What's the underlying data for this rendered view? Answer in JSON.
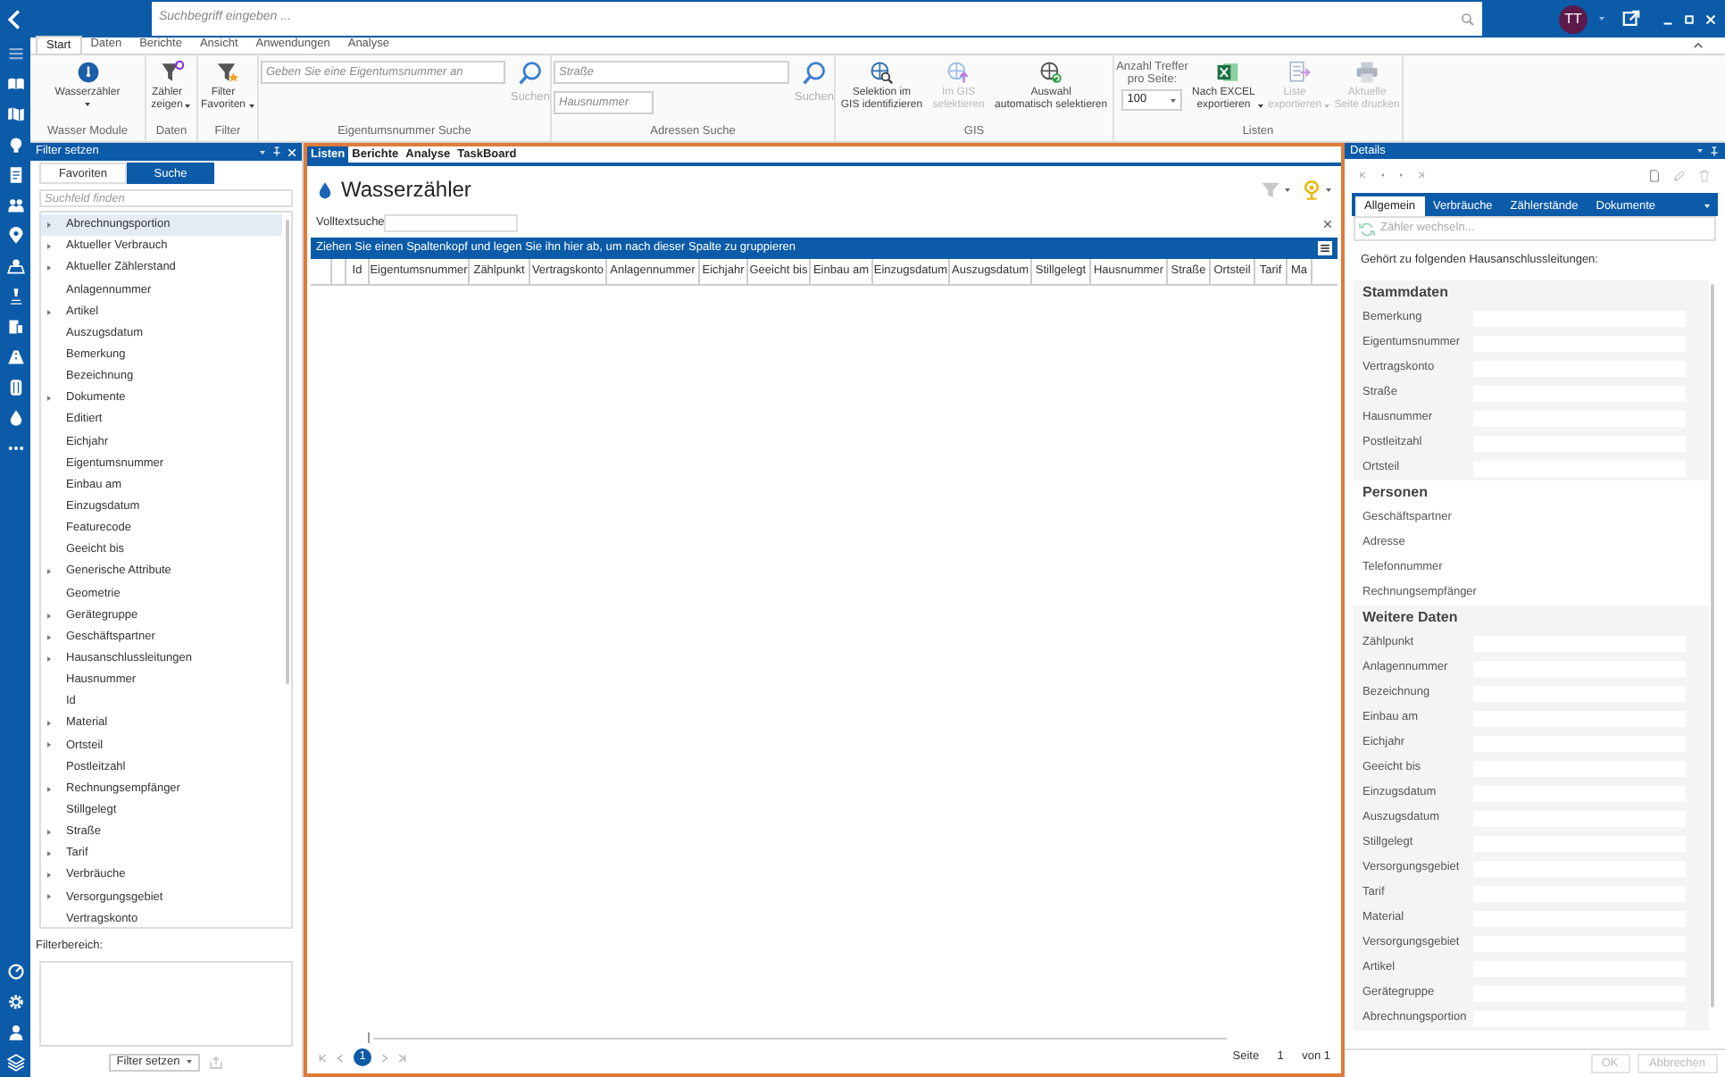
{
  "top_bar": {
    "search": {
      "placeholder": "Suchbegriff eingeben ..."
    },
    "avatar": "TT"
  },
  "ribbon": {
    "tabs": [
      {
        "label": "Start",
        "selected": true
      },
      {
        "label": "Daten",
        "selected": false
      },
      {
        "label": "Berichte",
        "selected": false
      },
      {
        "label": "Ansicht",
        "selected": false
      },
      {
        "label": "Anwendungen",
        "selected": false
      },
      {
        "label": "Analyse",
        "selected": false
      }
    ],
    "groups": [
      {
        "label": "Wasser Module",
        "items": [
          {
            "kind": "button",
            "label": "Wasserzähler",
            "dropdown": true,
            "disabled": false
          }
        ]
      },
      {
        "label": "Daten",
        "items": [
          {
            "kind": "button",
            "label": "Zähler\nzeigen",
            "dropdown": true,
            "disabled": false
          }
        ]
      },
      {
        "label": "Filter",
        "items": [
          {
            "kind": "button",
            "label": "Filter\nFavoriten",
            "dropdown": true,
            "disabled": false
          }
        ]
      },
      {
        "label": "Eigentumsnummer Suche",
        "items": [
          {
            "kind": "search",
            "fields": [
              {
                "placeholder": "Geben Sie eine Eigentumsnummer an"
              }
            ],
            "button": "Suchen"
          }
        ]
      },
      {
        "label": "Adressen Suche",
        "items": [
          {
            "kind": "search",
            "fields": [
              {
                "placeholder": "Straße"
              },
              {
                "placeholder": "Hausnummer"
              }
            ],
            "button": "Suchen"
          }
        ]
      },
      {
        "label": "GIS",
        "items": [
          {
            "kind": "button",
            "label": "Selektion im\nGIS identifizieren",
            "dropdown": false,
            "disabled": false
          },
          {
            "kind": "button",
            "label": "Im GIS\nselektieren",
            "dropdown": false,
            "disabled": true
          },
          {
            "kind": "button",
            "label": "Auswahl\nautomatisch selektieren",
            "dropdown": false,
            "disabled": false
          }
        ]
      },
      {
        "label": "Listen",
        "items": [
          {
            "kind": "select",
            "label": "Anzahl Treffer\npro Seite:",
            "value": "100"
          },
          {
            "kind": "button",
            "label": "Nach EXCEL\nexportieren",
            "dropdown": true,
            "disabled": false
          },
          {
            "kind": "button",
            "label": "Liste\nexportieren",
            "dropdown": true,
            "disabled": true
          },
          {
            "kind": "button",
            "label": "Aktuelle\nSeite drucken",
            "dropdown": false,
            "disabled": true
          }
        ]
      }
    ]
  },
  "filter_panel": {
    "title": "Filter setzen",
    "tabs": [
      {
        "label": "Favoriten",
        "selected": false
      },
      {
        "label": "Suche",
        "selected": true
      }
    ],
    "search": {
      "placeholder": "Suchfeld finden"
    },
    "fields": [
      {
        "label": "Abrechnungsportion",
        "expandable": true,
        "selected": true
      },
      {
        "label": "Aktueller Verbrauch",
        "expandable": true,
        "selected": false
      },
      {
        "label": "Aktueller Zählerstand",
        "expandable": true,
        "selected": false
      },
      {
        "label": "Anlagennummer",
        "expandable": false,
        "selected": false
      },
      {
        "label": "Artikel",
        "expandable": true,
        "selected": false
      },
      {
        "label": "Auszugsdatum",
        "expandable": false,
        "selected": false
      },
      {
        "label": "Bemerkung",
        "expandable": false,
        "selected": false
      },
      {
        "label": "Bezeichnung",
        "expandable": false,
        "selected": false
      },
      {
        "label": "Dokumente",
        "expandable": true,
        "selected": false
      },
      {
        "label": "Editiert",
        "expandable": false,
        "selected": false
      },
      {
        "label": "Eichjahr",
        "expandable": false,
        "selected": false
      },
      {
        "label": "Eigentumsnummer",
        "expandable": false,
        "selected": false
      },
      {
        "label": "Einbau am",
        "expandable": false,
        "selected": false
      },
      {
        "label": "Einzugsdatum",
        "expandable": false,
        "selected": false
      },
      {
        "label": "Featurecode",
        "expandable": false,
        "selected": false
      },
      {
        "label": "Geeicht bis",
        "expandable": false,
        "selected": false
      },
      {
        "label": "Generische Attribute",
        "expandable": true,
        "selected": false
      },
      {
        "label": "Geometrie",
        "expandable": false,
        "selected": false
      },
      {
        "label": "Gerätegruppe",
        "expandable": true,
        "selected": false
      },
      {
        "label": "Geschäftspartner",
        "expandable": true,
        "selected": false
      },
      {
        "label": "Hausanschlussleitungen",
        "expandable": true,
        "selected": false
      },
      {
        "label": "Hausnummer",
        "expandable": false,
        "selected": false
      },
      {
        "label": "Id",
        "expandable": false,
        "selected": false
      },
      {
        "label": "Material",
        "expandable": true,
        "selected": false
      },
      {
        "label": "Ortsteil",
        "expandable": true,
        "selected": false
      },
      {
        "label": "Postleitzahl",
        "expandable": false,
        "selected": false
      },
      {
        "label": "Rechnungsempfänger",
        "expandable": true,
        "selected": false
      },
      {
        "label": "Stillgelegt",
        "expandable": false,
        "selected": false
      },
      {
        "label": "Straße",
        "expandable": true,
        "selected": false
      },
      {
        "label": "Tarif",
        "expandable": true,
        "selected": false
      },
      {
        "label": "Verbräuche",
        "expandable": true,
        "selected": false
      },
      {
        "label": "Versorgungsgebiet",
        "expandable": true,
        "selected": false
      },
      {
        "label": "Vertragskonto",
        "expandable": false,
        "selected": false
      }
    ],
    "filter_area": {
      "label": "Filterbereich:"
    },
    "apply_button": "Filter setzen"
  },
  "list_view": {
    "tabs": [
      {
        "label": "Listen",
        "selected": true
      },
      {
        "label": "Berichte",
        "selected": false
      },
      {
        "label": "Analyse",
        "selected": false
      },
      {
        "label": "TaskBoard",
        "selected": false
      }
    ],
    "title": "Wasserzähler",
    "fulltext": {
      "label": "Volltextsuche"
    },
    "group_hint": "Ziehen Sie einen Spaltenkopf und legen Sie ihn hier ab, um nach dieser Spalte zu gruppieren",
    "columns": [
      "Id",
      "Eigentumsnummer",
      "Zählpunkt",
      "Vertragskonto",
      "Anlagennummer",
      "Eichjahr",
      "Geeicht bis",
      "Einbau am",
      "Einzugsdatum",
      "Auszugsdatum",
      "Stillgelegt",
      "Hausnummer",
      "Straße",
      "Ortsteil",
      "Tarif",
      "Ma"
    ],
    "pager": {
      "current_page": "1",
      "page_label": "Seite",
      "page_value": "1",
      "page_total": "von 1"
    }
  },
  "details": {
    "title": "Details",
    "tabs": [
      {
        "label": "Allgemein",
        "selected": true
      },
      {
        "label": "Verbräuche",
        "selected": false
      },
      {
        "label": "Zählerstände",
        "selected": false
      },
      {
        "label": "Dokumente",
        "selected": false
      }
    ],
    "meter_field": {
      "placeholder": "Zähler wechseln..."
    },
    "relation_text": "Gehört zu folgenden Hausanschlussleitungen:",
    "sections": [
      {
        "title": "Stammdaten",
        "kind": "form",
        "fields": [
          "Bemerkung",
          "Eigentumsnummer",
          "Vertragskonto",
          "Straße",
          "Hausnummer",
          "Postleitzahl",
          "Ortsteil"
        ]
      },
      {
        "title": "Personen",
        "kind": "info",
        "fields": [
          "Geschäftspartner",
          "Adresse",
          "Telefonnummer",
          "Rechnungsempfänger"
        ]
      },
      {
        "title": "Weitere Daten",
        "kind": "form",
        "fields": [
          "Zählpunkt",
          "Anlagennummer",
          "Bezeichnung",
          "Einbau am",
          "Eichjahr",
          "Geeicht bis",
          "Einzugsdatum",
          "Auszugsdatum",
          "Stillgelegt",
          "Versorgungsgebiet",
          "Tarif",
          "Material",
          "Versorgungsgebiet",
          "Artikel",
          "Gerätegruppe",
          "Abrechnungsportion"
        ]
      }
    ],
    "buttons": [
      {
        "label": "OK",
        "disabled": true
      },
      {
        "label": "Abbrechen",
        "disabled": true
      }
    ]
  }
}
